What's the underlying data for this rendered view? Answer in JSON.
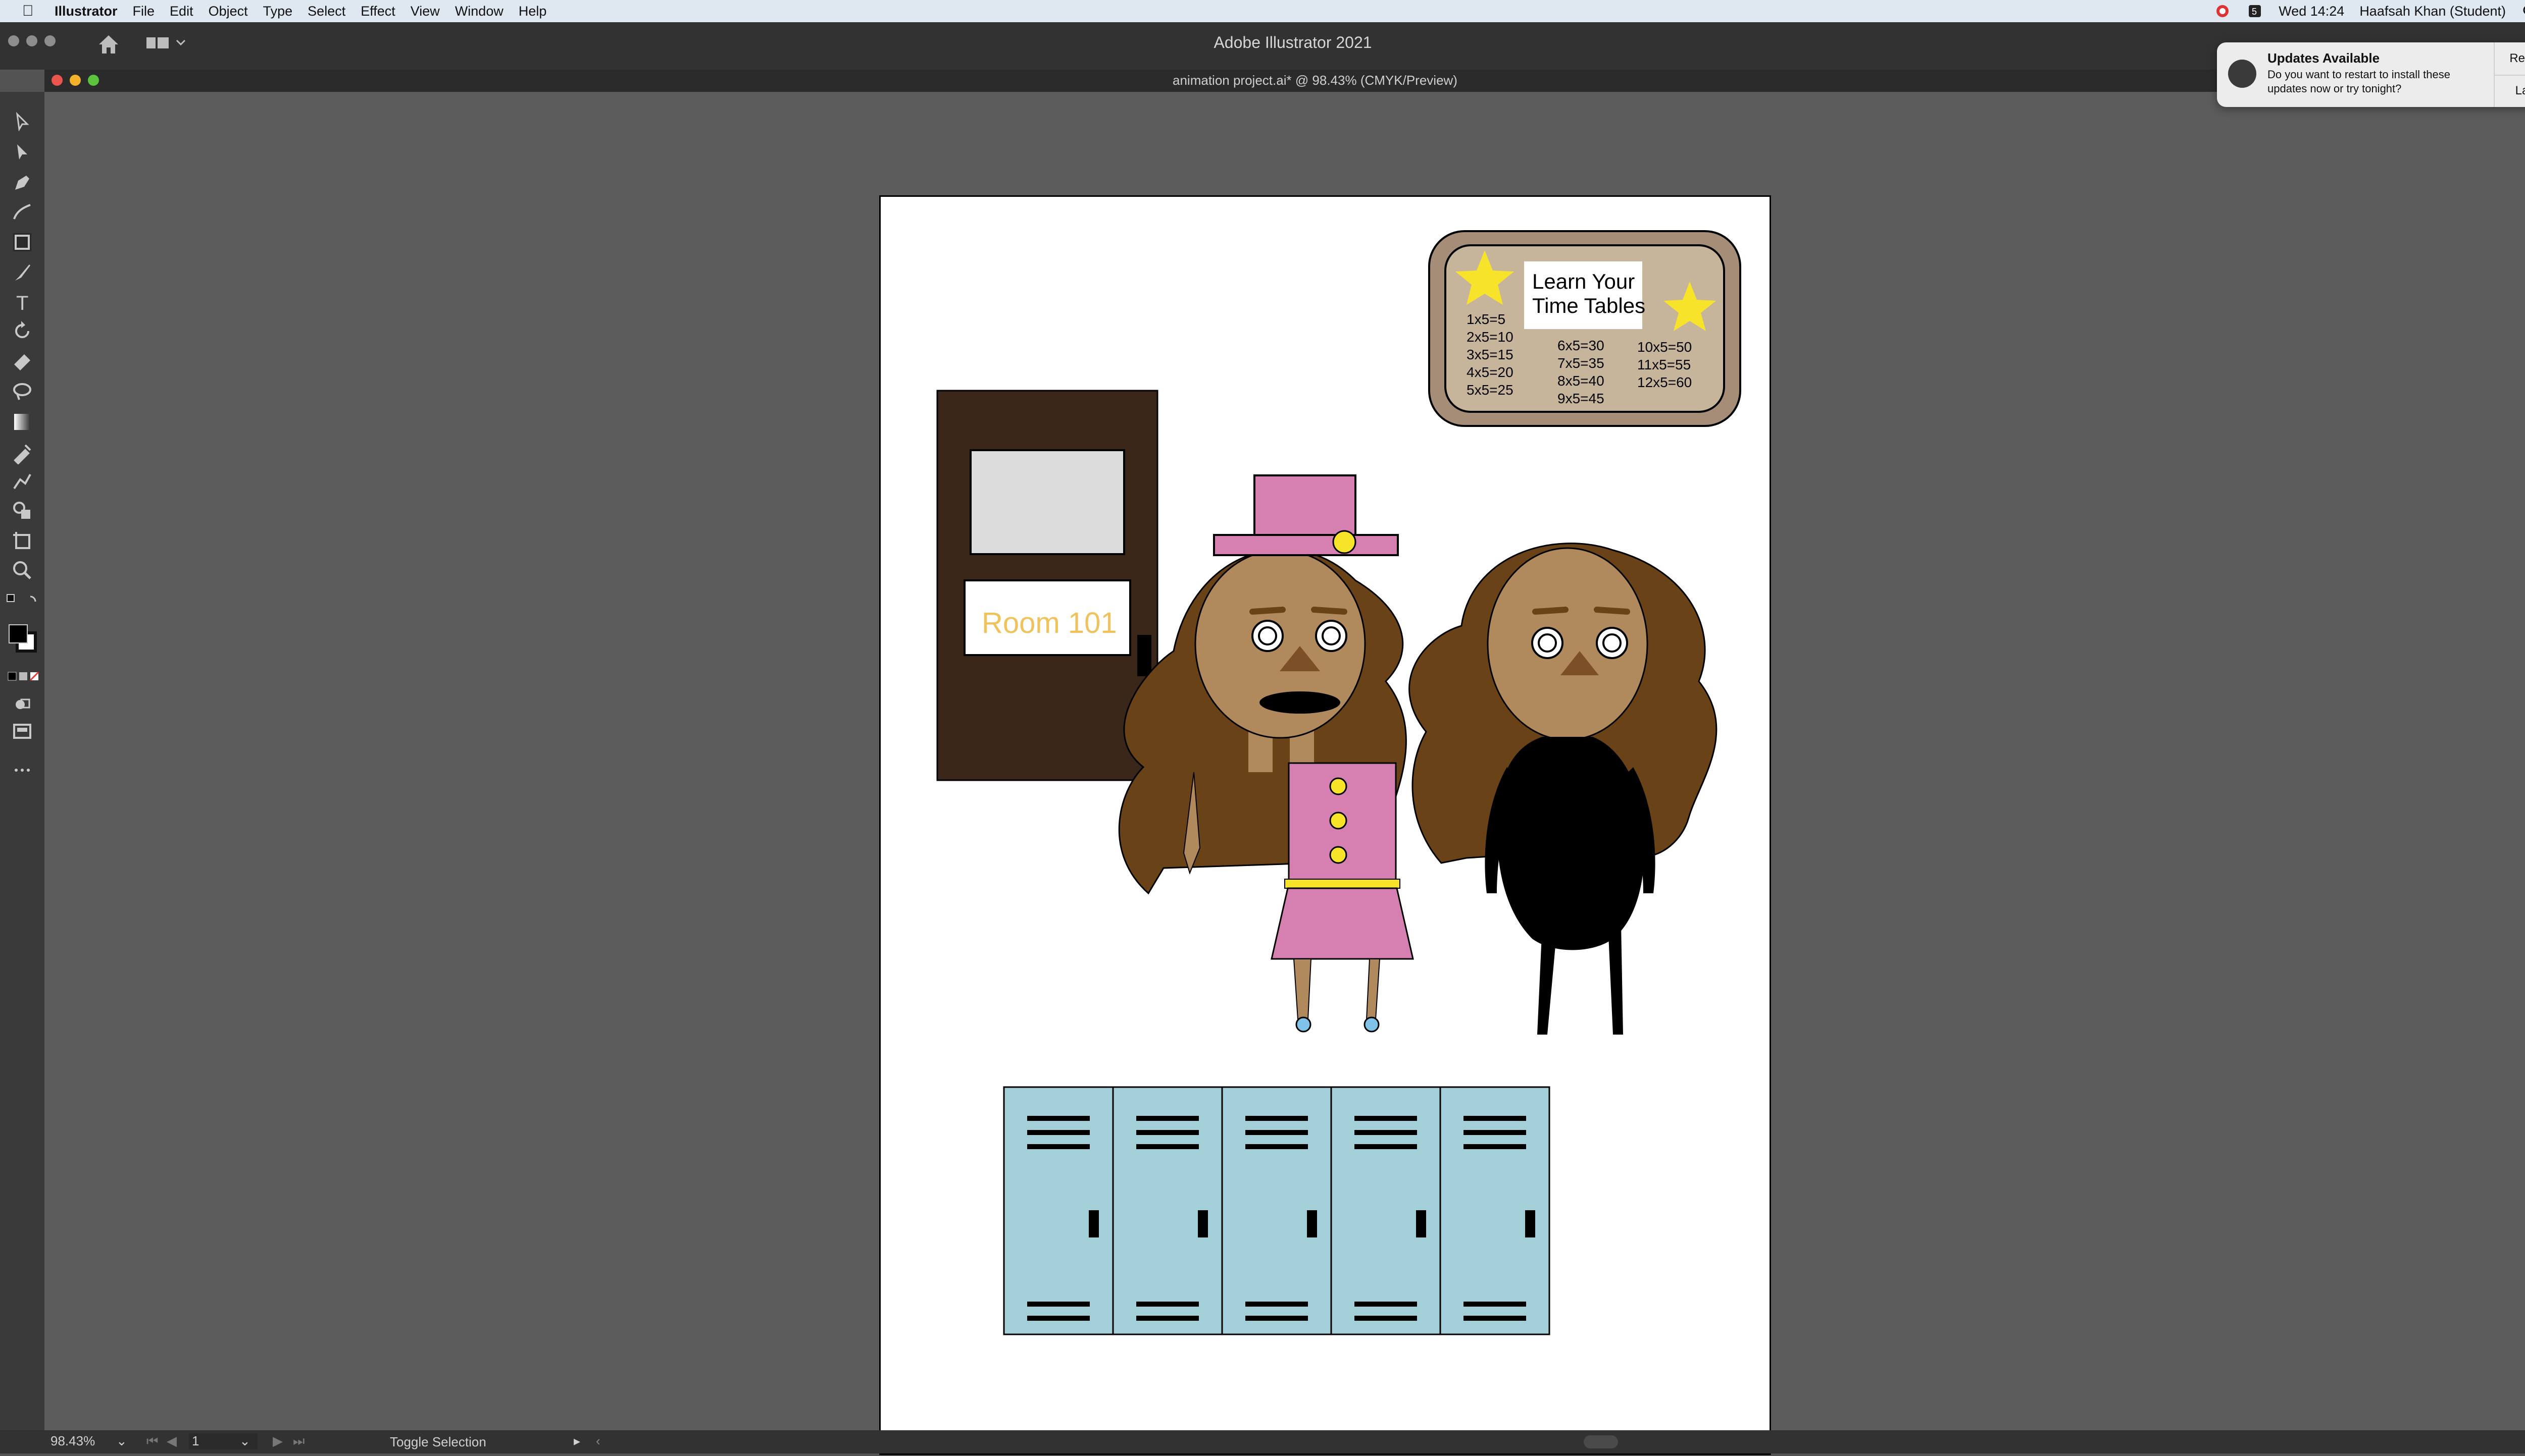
{
  "menubar": {
    "app_name": "Illustrator",
    "items": [
      "File",
      "Edit",
      "Object",
      "Type",
      "Select",
      "Effect",
      "View",
      "Window",
      "Help"
    ],
    "clock": "Wed 14:24",
    "user": "Haafsah Khan (Student)"
  },
  "window": {
    "title": "Adobe Illustrator 2021",
    "document_tab": "animation project.ai* @ 98.43% (CMYK/Preview)"
  },
  "toolbar": {
    "tools": [
      "selection-tool",
      "direct-selection-tool",
      "pen-tool",
      "curvature-tool",
      "rectangle-tool",
      "paintbrush-tool",
      "type-tool",
      "rotate-tool",
      "eraser-tool",
      "lasso-tool",
      "gradient-tool",
      "eyedropper-tool",
      "blend-tool",
      "shape-builder-tool",
      "artboard-tool",
      "zoom-tool",
      "more-tools"
    ],
    "fill_color": "#000000",
    "stroke_color": "#ffffff"
  },
  "artwork": {
    "board_title_line1": "Learn Your",
    "board_title_line2": "Time Tables",
    "times_col1": [
      "1x5=5",
      "2x5=10",
      "3x5=15",
      "4x5=20",
      "5x5=25"
    ],
    "times_col2": [
      "6x5=30",
      "7x5=35",
      "8x5=40",
      "9x5=45"
    ],
    "times_col3": [
      "10x5=50",
      "11x5=55",
      "12x5=60"
    ],
    "door_sign": "Room 101",
    "colors": {
      "door": "#3b271a",
      "board_frame": "#a58d78",
      "board_inner": "#c7b59b",
      "skin": "#b08a5d",
      "hair": "#6a4218",
      "dress": "#d67fb1",
      "button_yellow": "#f8e32b",
      "locker": "#a3d0d8",
      "sign_text": "#f0c25c"
    }
  },
  "statusbar": {
    "zoom": "98.43%",
    "page": "1",
    "status_label": "Toggle Selection"
  },
  "notification": {
    "title": "Updates Available",
    "body": "Do you want to restart to install these updates now or try tonight?",
    "restart_label": "Restart",
    "later_label": "Later"
  }
}
